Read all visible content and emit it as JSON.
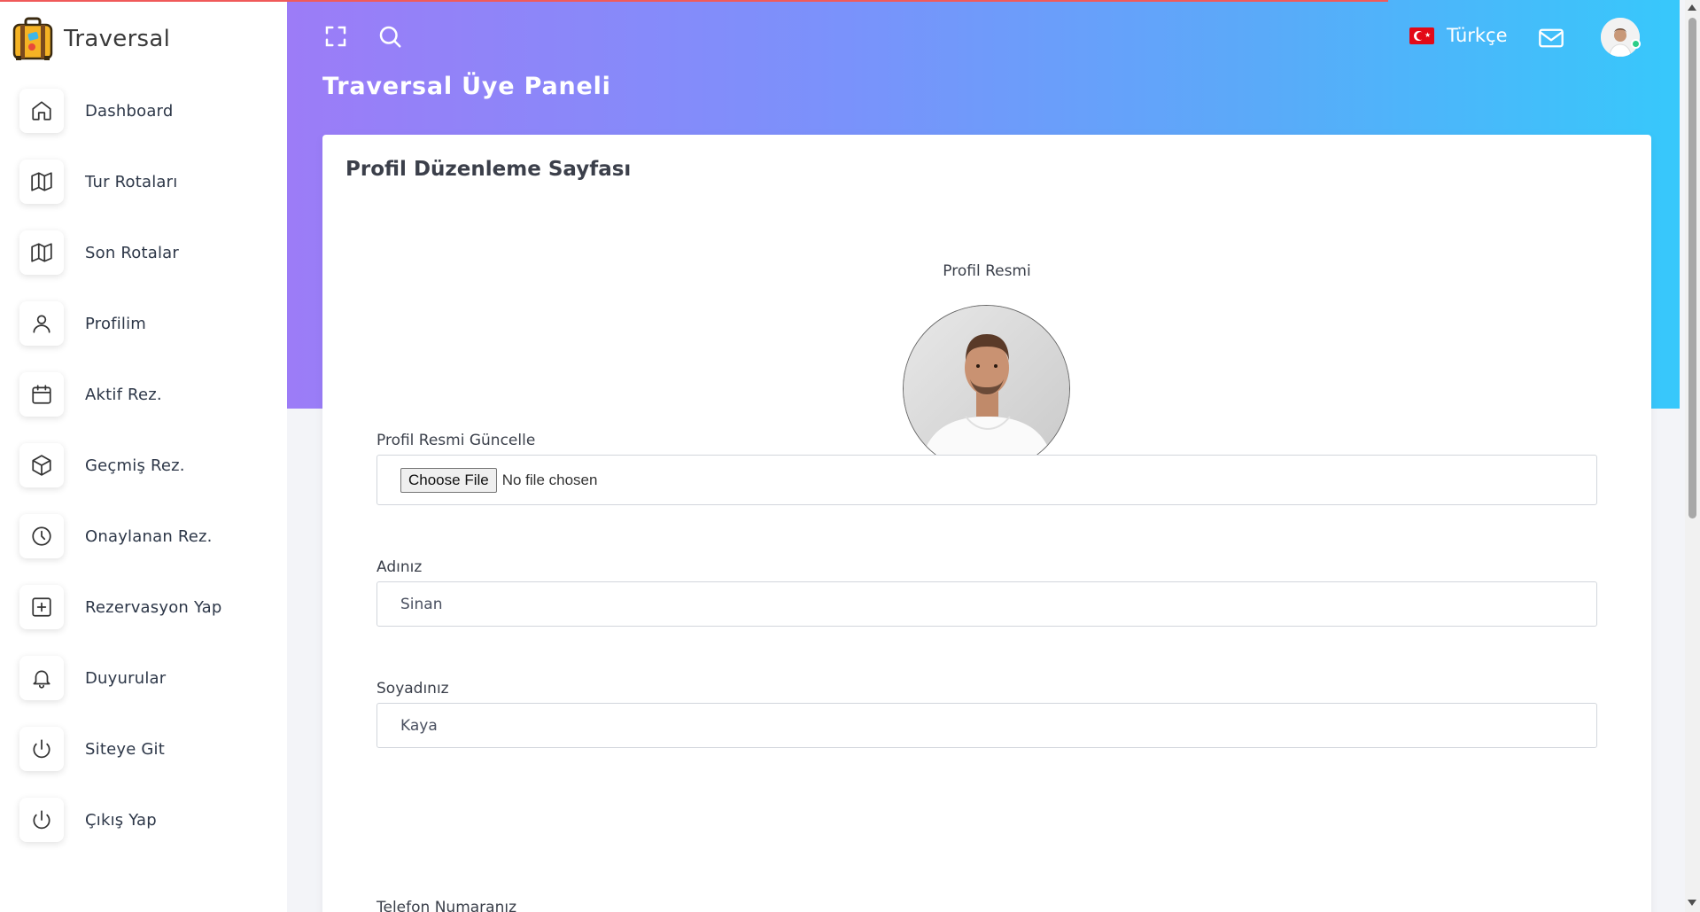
{
  "sidebar": {
    "brand": "Traversal",
    "items": [
      {
        "label": "Dashboard",
        "icon": "home-icon"
      },
      {
        "label": "Tur Rotaları",
        "icon": "map-icon"
      },
      {
        "label": "Son Rotalar",
        "icon": "map-icon"
      },
      {
        "label": "Profilim",
        "icon": "user-icon"
      },
      {
        "label": "Aktif Rez.",
        "icon": "calendar-icon"
      },
      {
        "label": "Geçmiş Rez.",
        "icon": "box-icon"
      },
      {
        "label": "Onaylanan Rez.",
        "icon": "clock-icon"
      },
      {
        "label": "Rezervasyon Yap",
        "icon": "plus-square-icon"
      },
      {
        "label": "Duyurular",
        "icon": "bell-icon"
      },
      {
        "label": "Siteye Git",
        "icon": "power-icon"
      },
      {
        "label": "Çıkış Yap",
        "icon": "power-icon"
      }
    ]
  },
  "header": {
    "title": "Traversal Üye Paneli",
    "language": "Türkçe"
  },
  "card": {
    "title": "Profil Düzenleme Sayfası",
    "photo_label": "Profil Resmi",
    "fields": {
      "photo_update": {
        "label": "Profil Resmi Güncelle",
        "button": "Choose File",
        "status": "No file chosen"
      },
      "first_name": {
        "label": "Adınız",
        "value": "Sinan"
      },
      "last_name": {
        "label": "Soyadınız",
        "value": "Kaya"
      },
      "phone": {
        "label": "Telefon Numaranız"
      }
    }
  },
  "colors": {
    "gradient_start": "#9c7cf7",
    "gradient_end": "#37c8fb",
    "online_status": "#2dce89"
  }
}
